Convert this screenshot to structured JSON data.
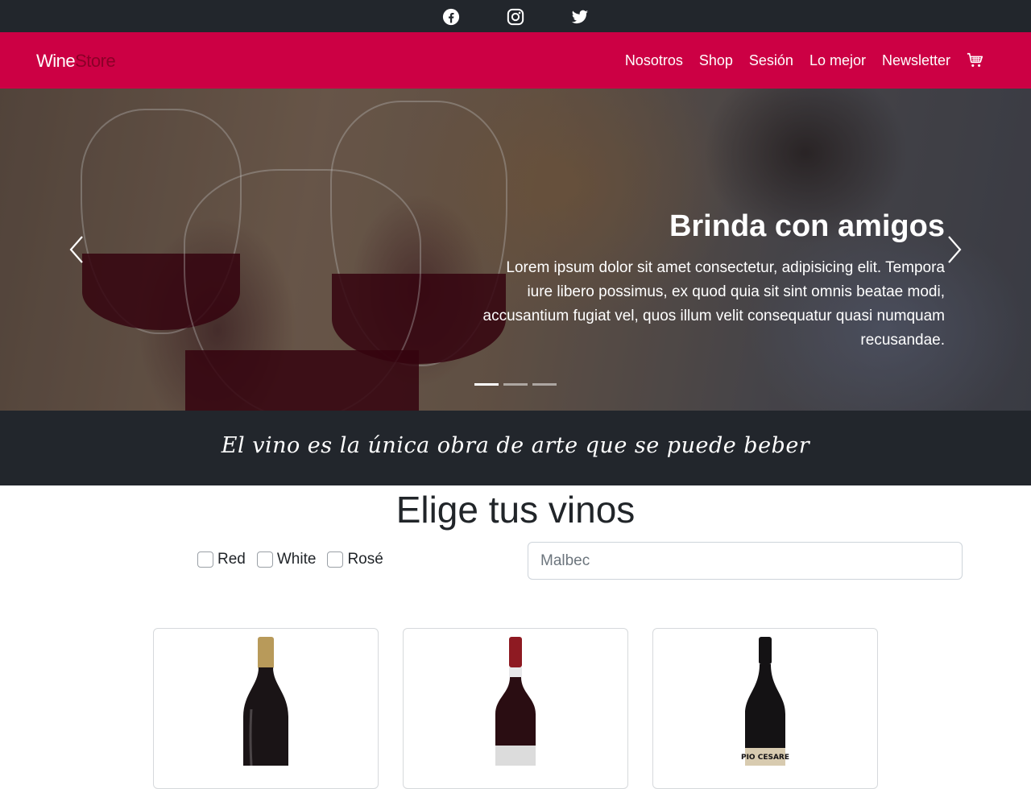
{
  "topbar": {
    "social_icons": [
      "facebook-icon",
      "instagram-icon",
      "twitter-icon"
    ]
  },
  "navbar": {
    "brand_wine": "Wine",
    "brand_store": "Store",
    "links": [
      "Nosotros",
      "Shop",
      "Sesión",
      "Lo mejor",
      "Newsletter"
    ],
    "cart_icon": "shopping-cart-icon",
    "background_color": "#cc0044"
  },
  "hero": {
    "title": "Brinda con amigos",
    "text": "Lorem ipsum dolor sit amet consectetur, adipisicing elit. Tempora iure libero possimus, ex quod quia sit sint omnis beatae modi, accusantium fugiat vel, quos illum velit consequatur quasi numquam recusandae.",
    "prev_icon": "chevron-left-icon",
    "next_icon": "chevron-right-icon",
    "slide_count": 3,
    "active_slide": 1
  },
  "quote": {
    "text": "El vino es la única obra de arte que se puede beber"
  },
  "products_section": {
    "title": "Elige tus vinos",
    "filters": [
      "Red",
      "White",
      "Rosé"
    ],
    "search_placeholder": "Malbec"
  },
  "products": [
    {
      "image": "wine-bottle-gold-capsule"
    },
    {
      "image": "wine-bottle-red-capsule"
    },
    {
      "image": "wine-bottle-pio-cesare",
      "label_text": "PIO CESARE"
    }
  ]
}
